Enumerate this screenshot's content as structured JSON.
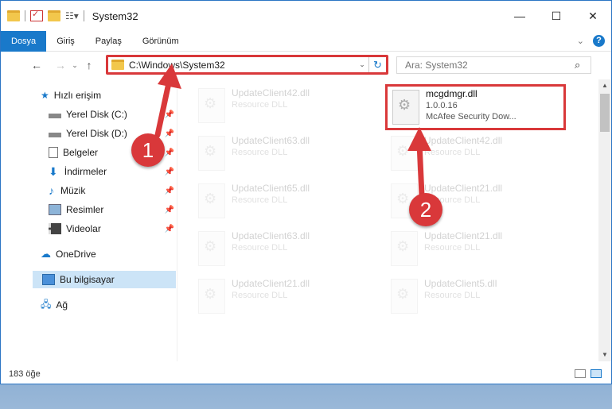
{
  "window": {
    "title": "System32",
    "controls": {
      "minimize": "—",
      "maximize": "☐",
      "close": "✕"
    }
  },
  "ribbon": {
    "tabs": [
      {
        "label": "Dosya",
        "active": true
      },
      {
        "label": "Giriş"
      },
      {
        "label": "Paylaş"
      },
      {
        "label": "Görünüm"
      }
    ]
  },
  "address": {
    "path": "C:\\Windows\\System32",
    "search_placeholder": "Ara: System32"
  },
  "navigation": {
    "items": [
      {
        "label": "Hızlı erişim",
        "icon": "star-icon"
      },
      {
        "label": "Yerel Disk (C:)",
        "icon": "drive-icon",
        "pinned": true
      },
      {
        "label": "Yerel Disk (D:)",
        "icon": "drive-icon",
        "pinned": true
      },
      {
        "label": "Belgeler",
        "icon": "document-icon",
        "pinned": true
      },
      {
        "label": "İndirmeler",
        "icon": "download-icon",
        "pinned": true
      },
      {
        "label": "Müzik",
        "icon": "music-icon",
        "pinned": true
      },
      {
        "label": "Resimler",
        "icon": "picture-icon",
        "pinned": true
      },
      {
        "label": "Videolar",
        "icon": "video-icon",
        "pinned": true
      },
      {
        "label": "OneDrive",
        "icon": "cloud-icon"
      },
      {
        "label": "Bu bilgisayar",
        "icon": "computer-icon",
        "selected": true
      },
      {
        "label": "Ağ",
        "icon": "network-icon"
      }
    ]
  },
  "files": {
    "highlighted": {
      "name": "mcgdmgr.dll",
      "version": "1.0.0.16",
      "description": "McAfee Security Dow..."
    },
    "left_column": [
      {
        "name": "UpdateClient42.dll",
        "sub": "Resource DLL"
      },
      {
        "name": "UpdateClient63.dll",
        "sub": "Resource DLL"
      },
      {
        "name": "UpdateClient65.dll",
        "sub": "Resource DLL"
      },
      {
        "name": "UpdateClient63.dll",
        "sub": "Resource DLL"
      },
      {
        "name": "UpdateClient21.dll",
        "sub": "Resource DLL"
      }
    ],
    "right_column": [
      {
        "name": "UpdateClient42.dll",
        "sub": "Resource DLL"
      },
      {
        "name": "UpdateClient21.dll",
        "sub": "Resource DLL"
      },
      {
        "name": "UpdateClient21.dll",
        "sub": "Resource DLL"
      },
      {
        "name": "UpdateClient5.dll",
        "sub": "Resource DLL"
      }
    ]
  },
  "status": {
    "count": "183 öğe"
  },
  "annotations": {
    "step1": "1",
    "step2": "2"
  },
  "colors": {
    "accent": "#1979ca",
    "highlight": "#d9383a"
  }
}
